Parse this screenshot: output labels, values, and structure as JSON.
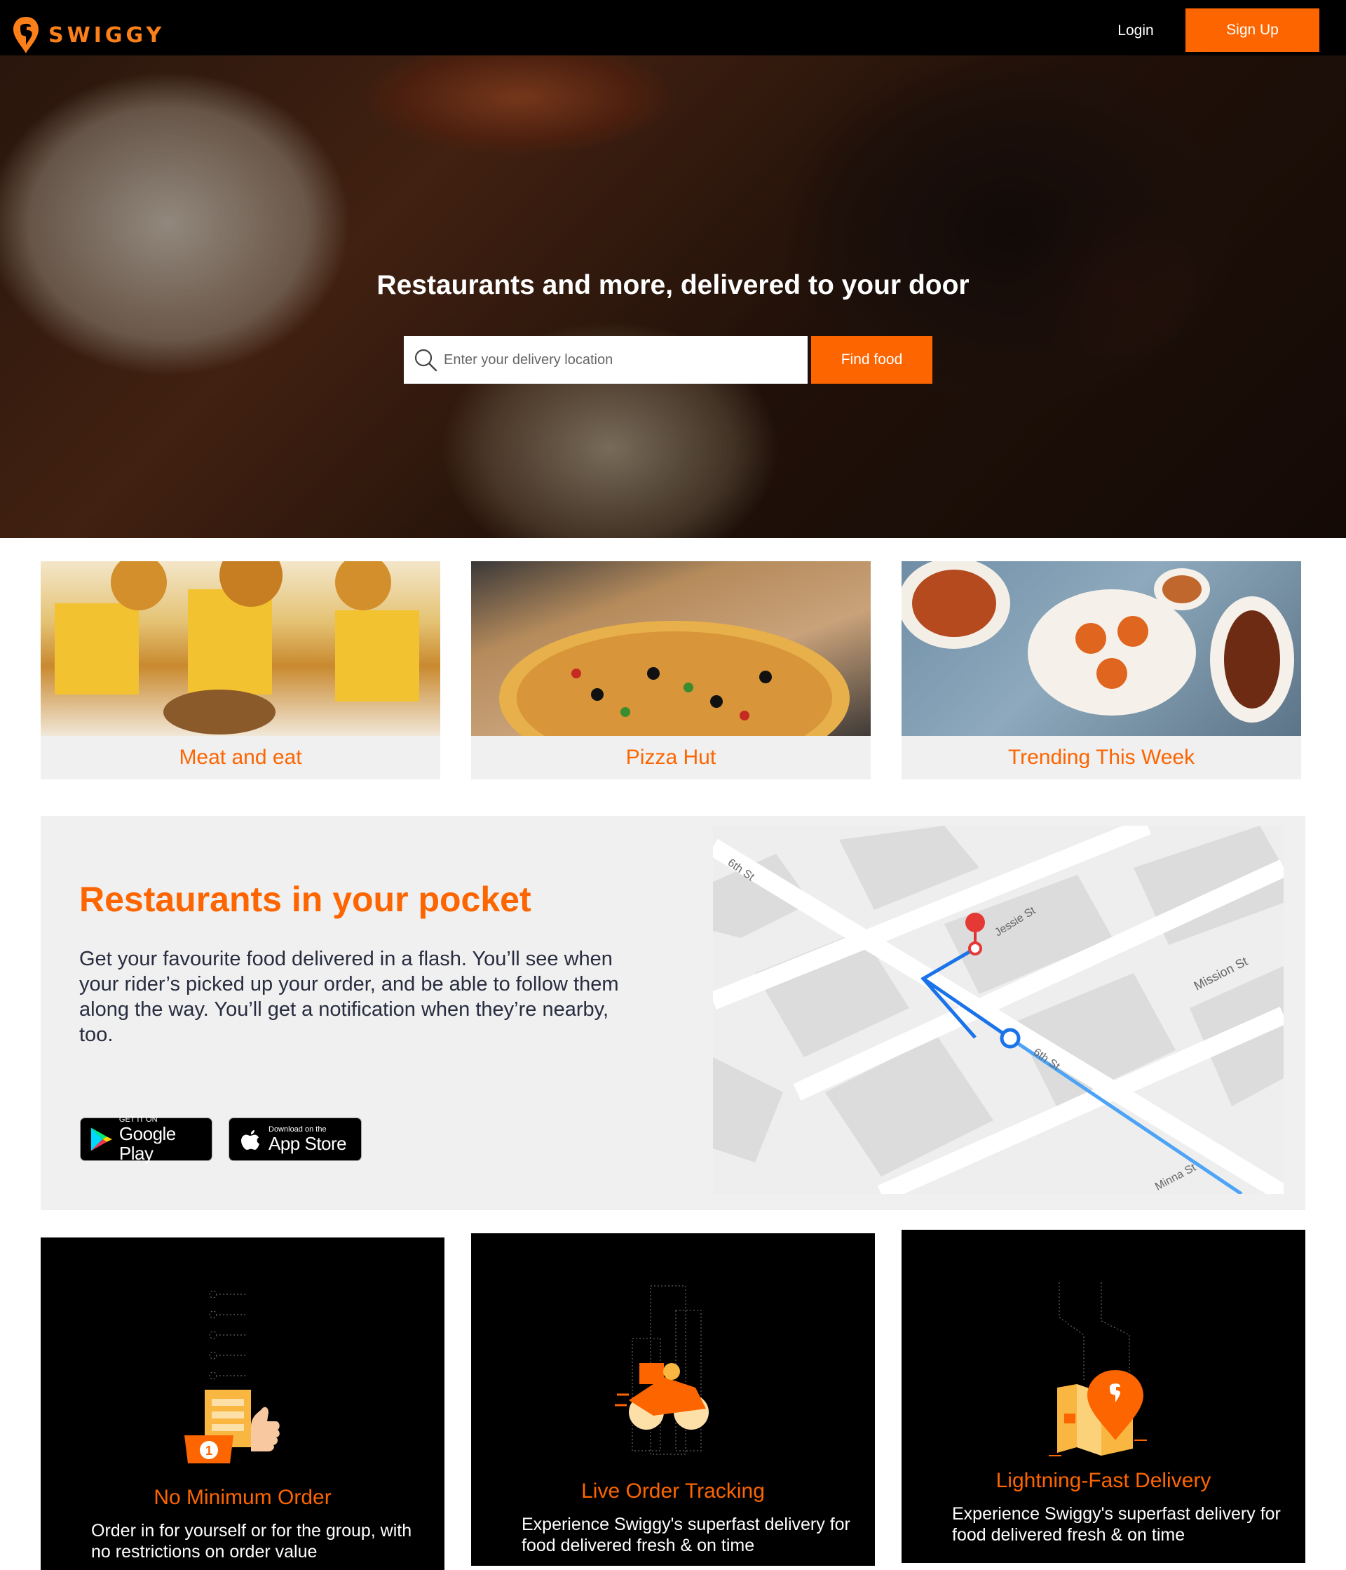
{
  "header": {
    "brand": "SWIGGY",
    "login_label": "Login",
    "signup_label": "Sign Up"
  },
  "hero": {
    "title": "Restaurants and more, delivered to your door",
    "search_placeholder": "Enter your delivery location",
    "find_label": "Find food"
  },
  "cards": [
    {
      "label": "Meat and eat"
    },
    {
      "label": "Pizza Hut"
    },
    {
      "label": "Trending This Week"
    }
  ],
  "pocket": {
    "title": "Restaurants in your pocket",
    "text": "Get your favourite food delivered in a flash. You’ll see when your rider’s picked up your order, and be able to follow them along the way. You’ll get a notification when they’re nearby, too.",
    "google_small": "GET IT ON",
    "google_big": "Google Play",
    "apple_small": "Download on the",
    "apple_big": "App Store",
    "map_streets": [
      "6th St",
      "Jessie St",
      "Mission St",
      "6th St",
      "Minna St"
    ]
  },
  "features": [
    {
      "title": "No Minimum Order",
      "desc": "Order in for yourself or for the group, with no restrictions on order value",
      "badge": "1"
    },
    {
      "title": "Live Order Tracking",
      "desc": "Experience Swiggy's superfast delivery for food delivered fresh & on time"
    },
    {
      "title": "Lightning-Fast Delivery",
      "desc": "Experience Swiggy's superfast delivery for food delivered fresh & on time"
    }
  ],
  "colors": {
    "accent": "#fc6500",
    "header_bg": "#000000",
    "card_bg": "#f0f0f0"
  },
  "icons": [
    "swiggy-logo-icon",
    "search-icon",
    "google-play-icon",
    "apple-icon",
    "map-pin-icon"
  ]
}
